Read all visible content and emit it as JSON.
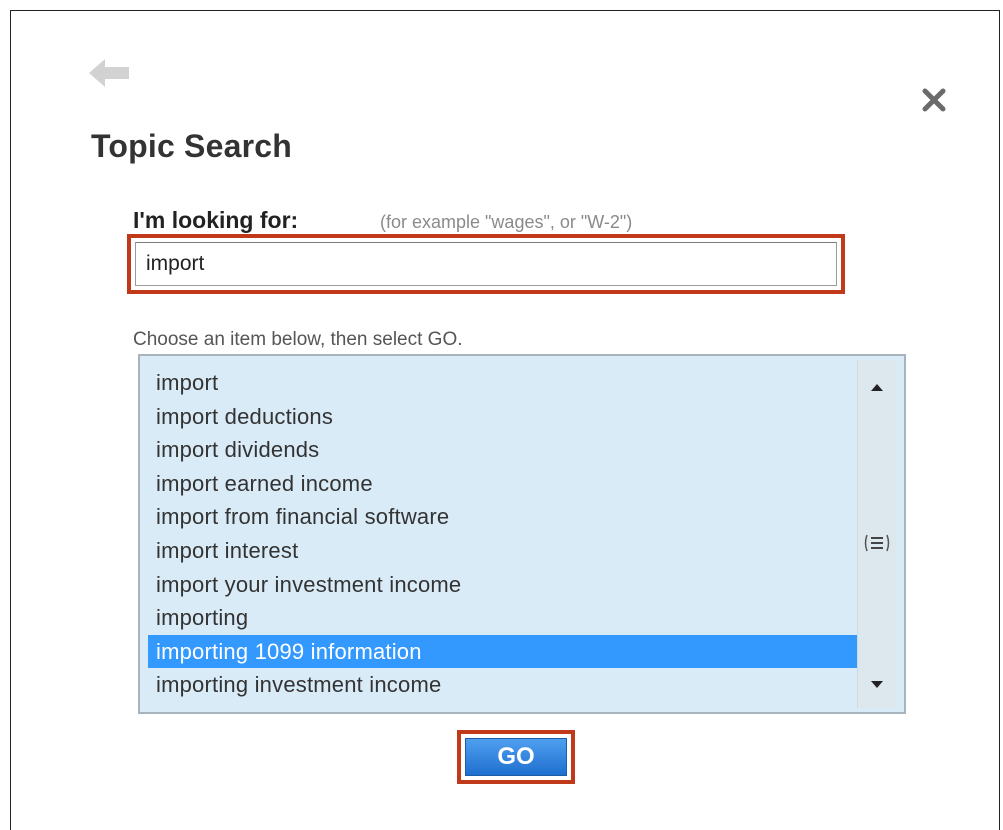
{
  "dialog": {
    "title": "Topic Search",
    "close_icon": "close-icon",
    "back_icon": "back-arrow-icon"
  },
  "search": {
    "label": "I'm looking for:",
    "hint": "(for example \"wages\", or \"W-2\")",
    "value": "import"
  },
  "results": {
    "instruction": "Choose an item below, then select GO.",
    "items": [
      "import",
      "import deductions",
      "import dividends",
      "import earned income",
      "import from financial software",
      "import interest",
      "import your investment income",
      "importing",
      "importing 1099 information",
      "importing investment income"
    ],
    "selected_index": 8
  },
  "actions": {
    "go_label": "GO"
  },
  "colors": {
    "highlight_border": "#c0391b",
    "list_background": "#d9ebf7",
    "selected_background": "#3399ff",
    "go_button": "#2a7fe0"
  }
}
